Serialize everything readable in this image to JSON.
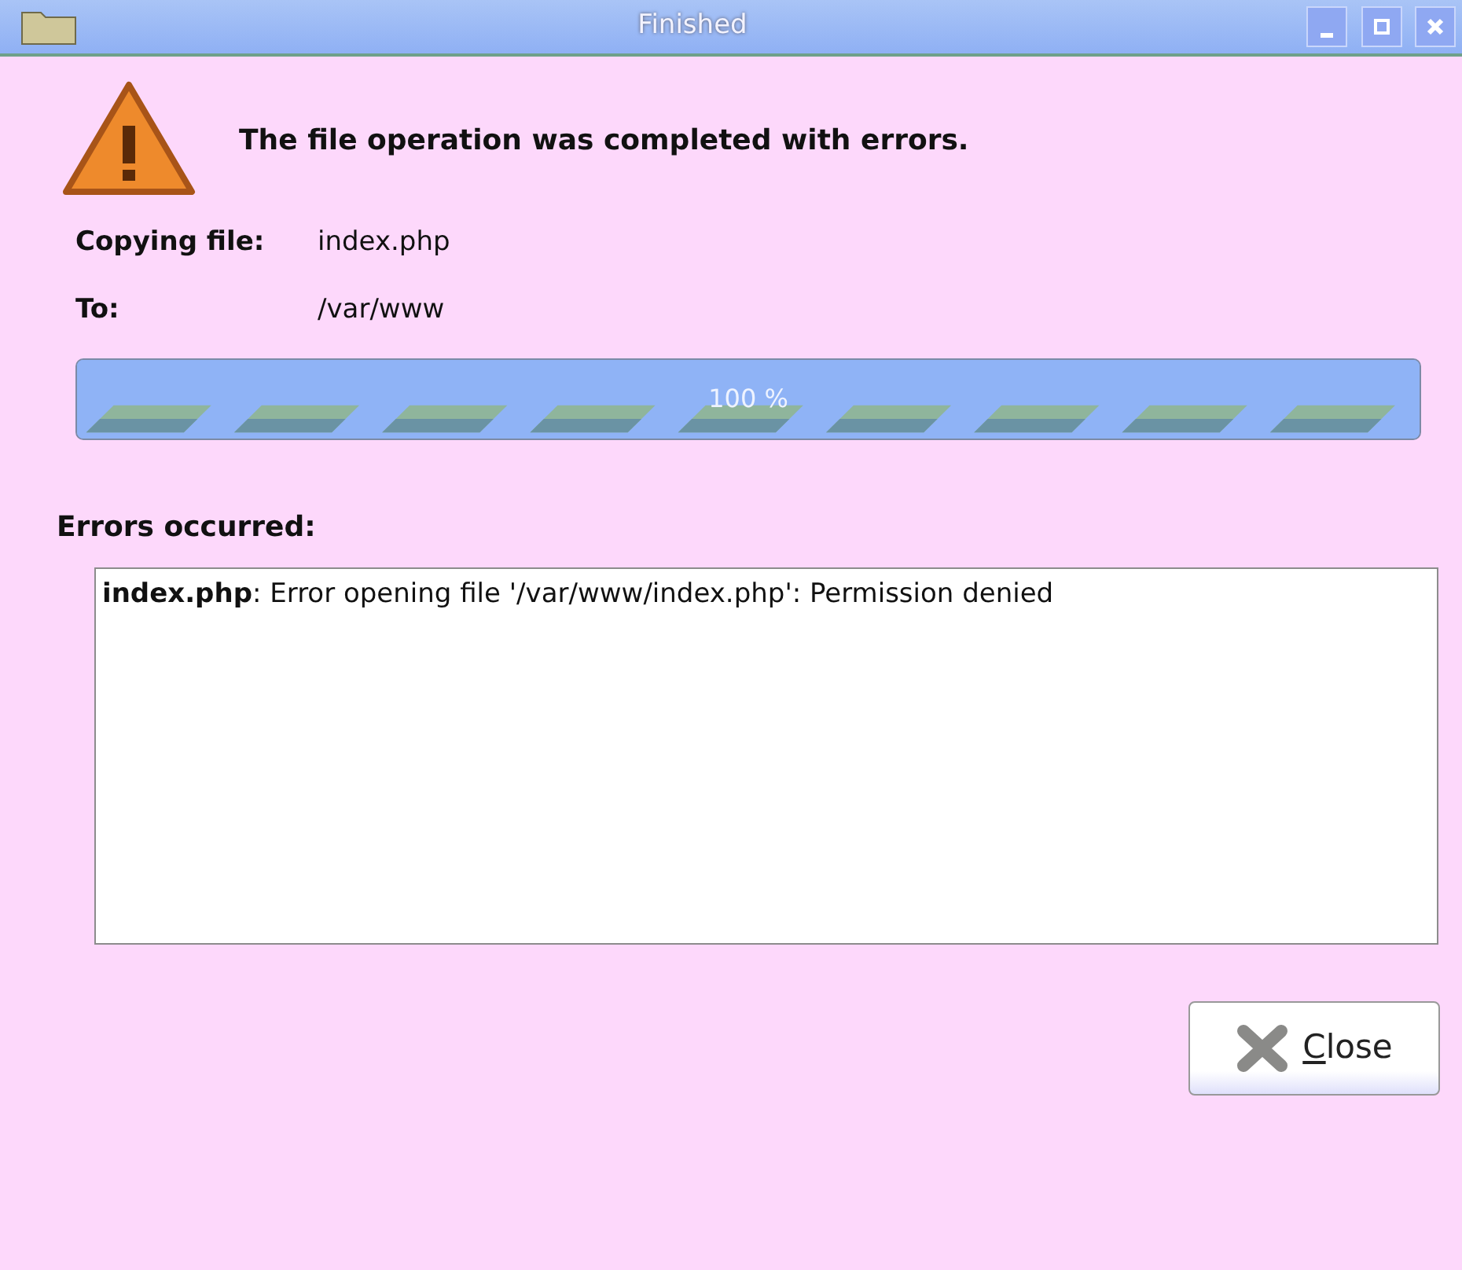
{
  "window": {
    "title": "Finished",
    "buttons": [
      {
        "kind": "minimize"
      },
      {
        "kind": "maximize"
      },
      {
        "kind": "close"
      }
    ]
  },
  "message": "The file operation was completed with errors.",
  "details": [
    {
      "label": "Copying file:",
      "value": "index.php"
    },
    {
      "label": "To:",
      "value": "/var/www"
    }
  ],
  "progress": {
    "level": 1,
    "reading": "100 %"
  },
  "errors": {
    "heading": "Errors occurred:",
    "lines": [
      "**index.php**: Error opening file '/var/www/index.php': Permission denied"
    ]
  },
  "buttons": [
    {
      "label": "Close"
    }
  ]
}
